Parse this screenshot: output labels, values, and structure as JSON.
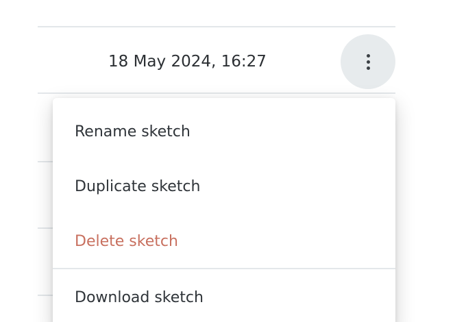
{
  "list": {
    "rows": [
      {
        "date": "18 May 2024, 16:27"
      }
    ],
    "previous_row_partial_text": "",
    "row_menu_button": {
      "icon": "more-vertical-icon"
    }
  },
  "context_menu": {
    "items": [
      {
        "label": "Rename sketch",
        "style": "normal"
      },
      {
        "label": "Duplicate sketch",
        "style": "normal"
      },
      {
        "label": "Delete sketch",
        "style": "danger"
      },
      {
        "label": "Download sketch",
        "style": "normal"
      }
    ]
  },
  "colors": {
    "text": "#2b2f33",
    "danger": "#c8705f",
    "button_bg": "#e7ebed",
    "divider": "#e3e7ea"
  }
}
